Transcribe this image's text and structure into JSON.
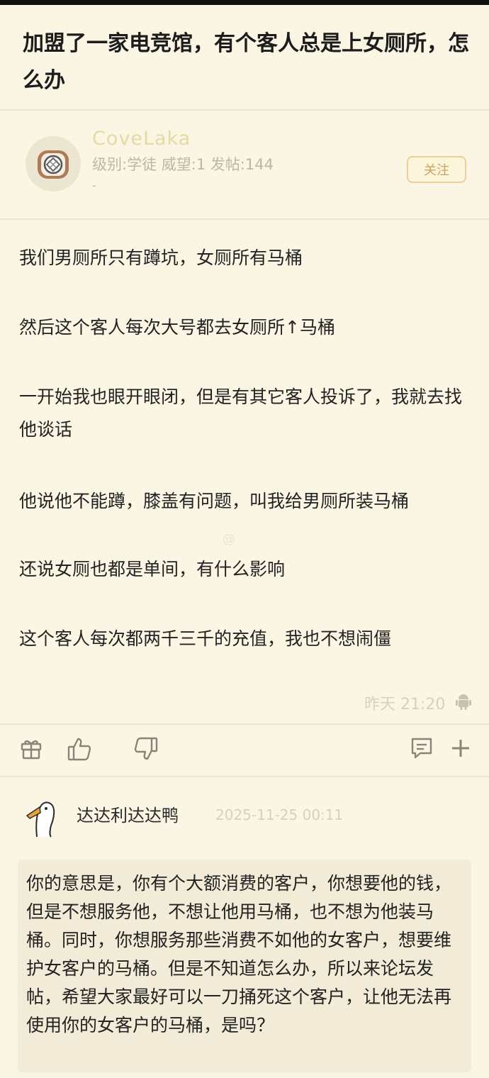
{
  "post": {
    "title": "加盟了一家电竞馆，有个客人总是上女厕所，怎么办"
  },
  "author": {
    "name": "CoveLaka",
    "stats": "级别:学徒 威望:1 发帖:144",
    "extra": "-",
    "follow_label": "关注"
  },
  "content": {
    "paragraphs": [
      "我们男厕所只有蹲坑，女厕所有马桶",
      "然后这个客人每次大号都去女厕所↑马桶",
      "一开始我也眼开眼闭，但是有其它客人投诉了，我就去找他谈话",
      "他说他不能蹲，膝盖有问题，叫我给男厕所装马桶",
      "还说女厕也都是单间，有什么影响",
      "这个客人每次都两千三千的充值，我也不想闹僵"
    ],
    "watermark": "@",
    "timestamp": "昨天 21:20"
  },
  "icons": {
    "gift": "gift-icon",
    "like": "thumbs-up-icon",
    "dislike": "thumbs-down-icon",
    "comment": "comment-icon",
    "more": "plus-icon",
    "device": "android-icon"
  },
  "reply": {
    "name": "达达利达达鸭",
    "time": "2025-11-25 00:11",
    "text": "你的意思是，你有个大额消费的客户，你想要他的钱，但是不想服务他，不想让他用马桶，也不想为他装马桶。同时，你想服务那些消费不如他的女客户，想要维护女客户的马桶。但是不知道怎么办，所以来论坛发帖，希望大家最好可以一刀捅死这个客户，让他无法再使用你的女客户的马桶，是吗？"
  },
  "colors": {
    "background": "#fbf6e4",
    "accent": "#c9a65a",
    "muted": "#bcb6a8"
  }
}
